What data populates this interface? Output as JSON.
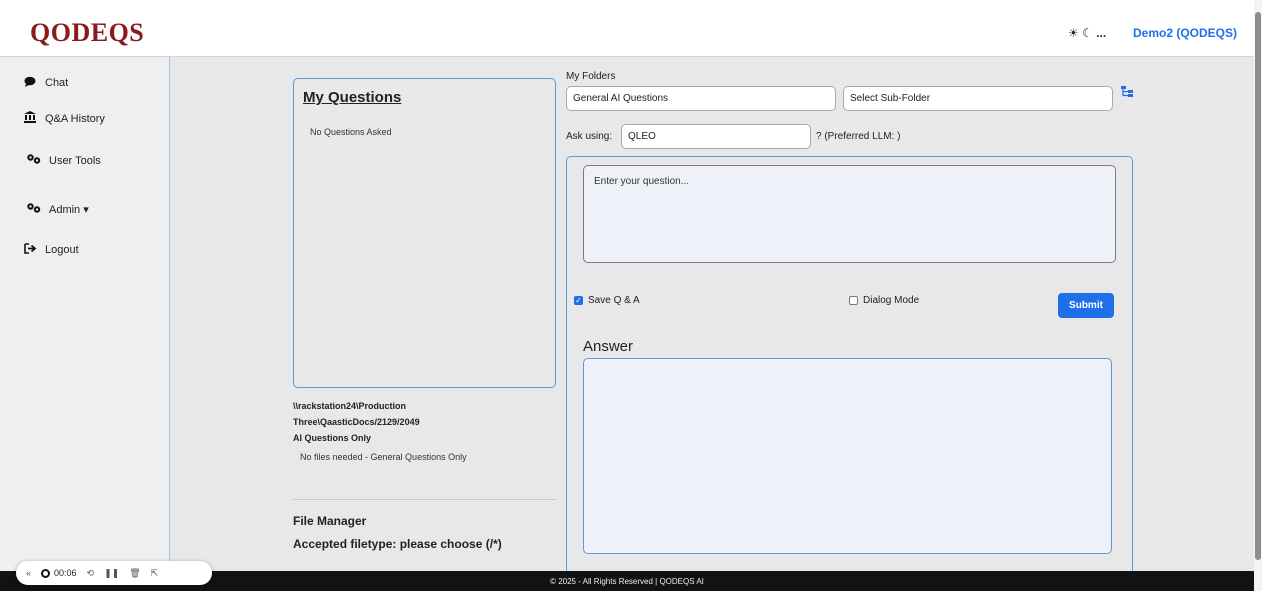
{
  "header": {
    "logo": "QODEQS",
    "theme_toggle": "☀ ☾ ...",
    "user": "Demo2 (QODEQS)"
  },
  "sidebar": {
    "items": [
      {
        "label": "Chat",
        "icon": "chat-bubble-icon"
      },
      {
        "label": "Q&A History",
        "icon": "bank-icon"
      },
      {
        "label": "User Tools",
        "icon": "gears-icon"
      },
      {
        "label": "Admin ▾",
        "icon": "gears-icon"
      },
      {
        "label": "Logout",
        "icon": "logout-icon"
      }
    ]
  },
  "questions": {
    "title": "My Questions",
    "empty": "No Questions Asked"
  },
  "path": {
    "line1": "\\\\rackstation24\\Production",
    "line2": "Three\\QaasticDocs/2129/2049",
    "line3": "AI Questions Only",
    "nofiles": "No files needed - General Questions Only"
  },
  "file_manager": {
    "title": "File Manager",
    "accepted": "Accepted filetype: please choose (/*)"
  },
  "folders": {
    "label": "My Folders",
    "folder_value": "General AI Questions",
    "subfolder_value": "Select Sub-Folder"
  },
  "ask": {
    "label": "Ask using:",
    "value": "QLEO",
    "preferred": "? (Preferred LLM: )"
  },
  "question": {
    "placeholder": "Enter your question...",
    "save_label": "Save Q & A",
    "dialog_label": "Dialog Mode",
    "submit": "Submit"
  },
  "answer": {
    "label": "Answer"
  },
  "footer": {
    "text": "© 2025 - All Rights Reserved | QODEQS AI"
  },
  "recorder": {
    "time": "00:06"
  },
  "colors": {
    "accent": "#1f6feb",
    "brand": "#8b1a1a",
    "border": "#5b9bd5"
  }
}
